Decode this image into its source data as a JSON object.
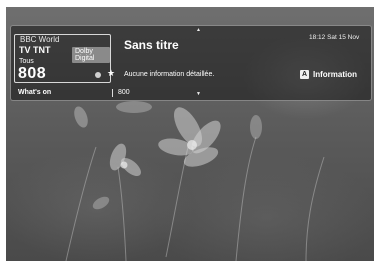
{
  "channel": {
    "name": "BBC World",
    "source": "TV TNT",
    "audio_badge": "Dolby Digital",
    "group": "Tous",
    "number": "808",
    "whats_on": "What's on",
    "list_number": "800"
  },
  "program": {
    "title": "Sans titre",
    "info": "Aucune information détaillée.",
    "clock": "18:12 Sat 15 Nov"
  },
  "info_button": {
    "key": "A",
    "label": "Information"
  },
  "icons": {
    "star": "★",
    "up": "▲",
    "down": "▼"
  }
}
